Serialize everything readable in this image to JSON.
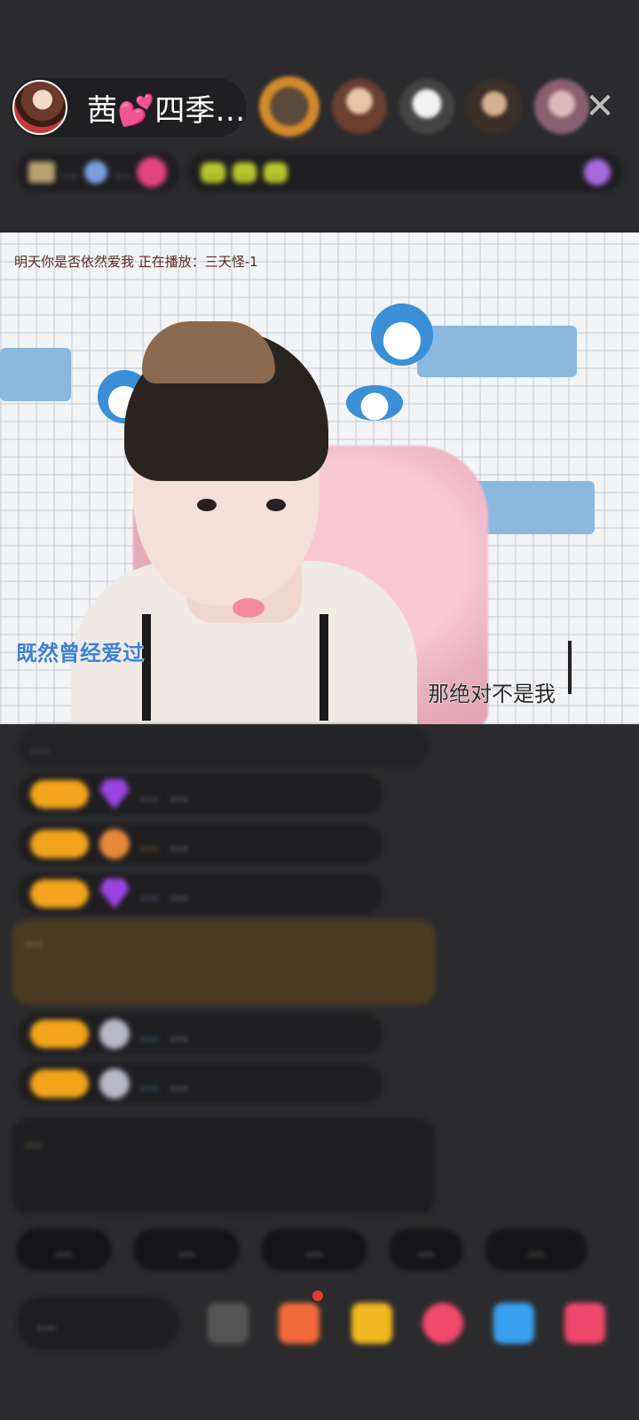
{
  "header": {
    "host_name": "茜💕四季…",
    "viewer_avatar_icons": [
      "viewer-avatar-1",
      "viewer-avatar-2",
      "viewer-avatar-3",
      "viewer-avatar-4",
      "viewer-avatar-5"
    ],
    "close_icon": "✕"
  },
  "info_row": {
    "rank_text": "...",
    "popularity_text": "...",
    "task_chips": [
      "...",
      "...",
      "..."
    ]
  },
  "video": {
    "marquee": "明天你是否依然爱我 正在播放：三天怪-1",
    "lyric_left": "既然曾经爱过",
    "lyric_right": "那绝对不是我"
  },
  "chat": {
    "top_blurred": "...",
    "messages": [
      {
        "name": "...",
        "text": "..."
      },
      {
        "name": "...",
        "text": "..."
      },
      {
        "name": "...",
        "text": "..."
      },
      {
        "name": "...",
        "text": "..."
      },
      {
        "name": "...",
        "text": "..."
      }
    ],
    "gold_message": "...",
    "system_message": "..."
  },
  "quick_replies": [
    "...",
    "...",
    "...",
    "...",
    "..."
  ],
  "bottom": {
    "say_placeholder": "..."
  }
}
